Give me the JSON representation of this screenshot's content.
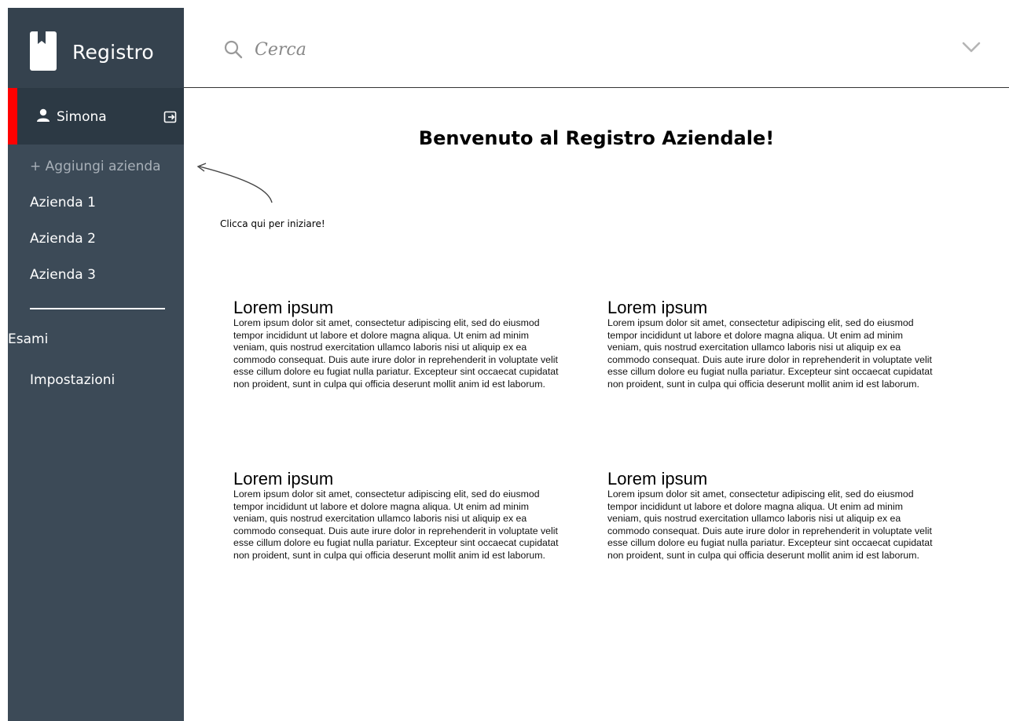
{
  "sidebar": {
    "brand_title": "Registro",
    "user": {
      "name": "Simona"
    },
    "add_company_label": "+ Aggiungi azienda",
    "companies": [
      "Azienda 1",
      "Azienda 2",
      "Azienda 3"
    ],
    "links": [
      "Esami",
      "Impostazioni"
    ],
    "accent_color": "#ff0000"
  },
  "topbar": {
    "search_placeholder": "Cerca"
  },
  "main": {
    "welcome": "Benvenuto al Registro Aziendale!",
    "hint": "Clicca qui per iniziare!",
    "cards": [
      {
        "title": "Lorem ipsum",
        "body": "Lorem ipsum dolor sit amet, consectetur adipiscing elit, sed do eiusmod tempor incididunt ut labore et dolore magna aliqua. Ut enim ad minim veniam, quis nostrud exercitation ullamco laboris nisi ut aliquip ex ea commodo consequat. Duis aute irure dolor in reprehenderit in voluptate velit esse cillum dolore eu fugiat nulla pariatur. Excepteur sint occaecat cupidatat non proident, sunt in culpa qui officia deserunt mollit anim id est laborum."
      },
      {
        "title": "Lorem ipsum",
        "body": "Lorem ipsum dolor sit amet, consectetur adipiscing elit, sed do eiusmod tempor incididunt ut labore et dolore magna aliqua. Ut enim ad minim veniam, quis nostrud exercitation ullamco laboris nisi ut aliquip ex ea commodo consequat. Duis aute irure dolor in reprehenderit in voluptate velit esse cillum dolore eu fugiat nulla pariatur. Excepteur sint occaecat cupidatat non proident, sunt in culpa qui officia deserunt mollit anim id est laborum."
      },
      {
        "title": "Lorem ipsum",
        "body": "Lorem ipsum dolor sit amet, consectetur adipiscing elit, sed do eiusmod tempor incididunt ut labore et dolore magna aliqua. Ut enim ad minim veniam, quis nostrud exercitation ullamco laboris nisi ut aliquip ex ea commodo consequat. Duis aute irure dolor in reprehenderit in voluptate velit esse cillum dolore eu fugiat nulla pariatur. Excepteur sint occaecat cupidatat non proident, sunt in culpa qui officia deserunt mollit anim id est laborum."
      },
      {
        "title": "Lorem ipsum",
        "body": "Lorem ipsum dolor sit amet, consectetur adipiscing elit, sed do eiusmod tempor incididunt ut labore et dolore magna aliqua. Ut enim ad minim veniam, quis nostrud exercitation ullamco laboris nisi ut aliquip ex ea commodo consequat. Duis aute irure dolor in reprehenderit in voluptate velit esse cillum dolore eu fugiat nulla pariatur. Excepteur sint occaecat cupidatat non proident, sunt in culpa qui officia deserunt mollit anim id est laborum."
      }
    ]
  },
  "icons": {
    "brand": "bookmark-icon",
    "user": "user-icon",
    "logout": "logout-icon",
    "search": "search-icon",
    "dropdown": "chevron-down-icon"
  }
}
